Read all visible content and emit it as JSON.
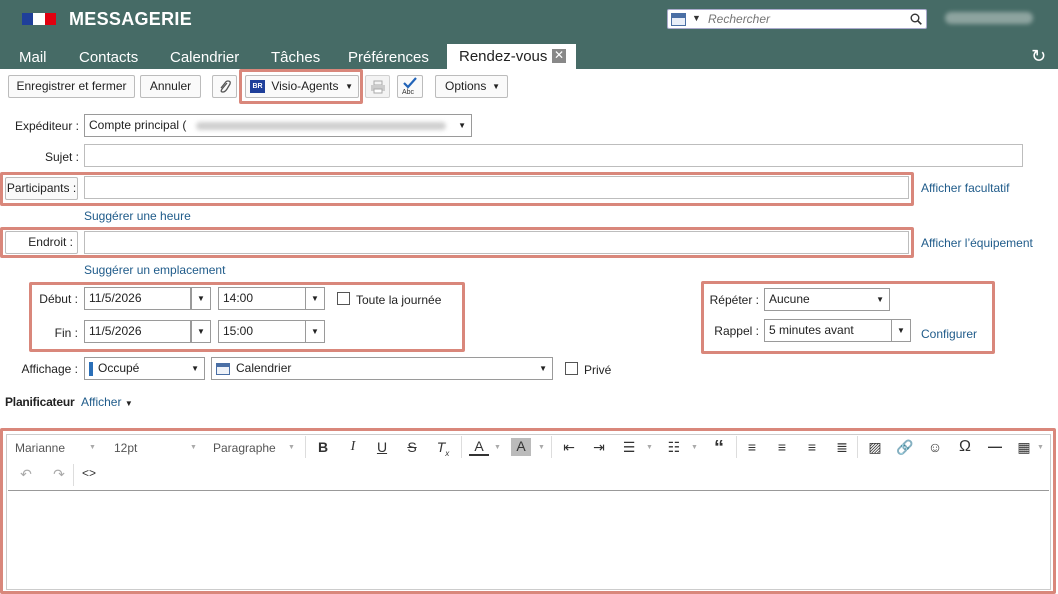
{
  "header": {
    "brand": "MESSAGERIE",
    "search_placeholder": "Rechercher",
    "colors": {
      "header_bg": "#466b66",
      "highlight": "#d9877b",
      "link": "#1f5b8a"
    }
  },
  "tabs": [
    "Mail",
    "Contacts",
    "Calendrier",
    "Tâches",
    "Préférences"
  ],
  "active_tab": "Rendez-vous",
  "toolbar": {
    "save_close": "Enregistrer et fermer",
    "cancel": "Annuler",
    "visio": "Visio-Agents",
    "options": "Options"
  },
  "form": {
    "sender_label": "Expéditeur :",
    "sender_value": "Compte principal (",
    "subject_label": "Sujet :",
    "participants_label": "Participants :",
    "show_optional": "Afficher facultatif",
    "suggest_time": "Suggérer une heure",
    "location_label": "Endroit :",
    "show_equipment": "Afficher l’équipement",
    "suggest_location": "Suggérer un emplacement",
    "start_label": "Début :",
    "start_date": "11/5/2026",
    "start_time": "14:00",
    "end_label": "Fin :",
    "end_date": "11/5/2026",
    "end_time": "15:00",
    "all_day": "Toute la journée",
    "repeat_label": "Répéter :",
    "repeat_value": "Aucune",
    "reminder_label": "Rappel :",
    "reminder_value": "5 minutes avant",
    "configure": "Configurer",
    "display_label": "Affichage :",
    "display_value": "Occupé",
    "calendar_value": "Calendrier",
    "private": "Privé",
    "planner_label": "Planificateur",
    "planner_show": "Afficher"
  },
  "editor": {
    "font": "Marianne",
    "size": "12pt",
    "block": "Paragraphe"
  }
}
